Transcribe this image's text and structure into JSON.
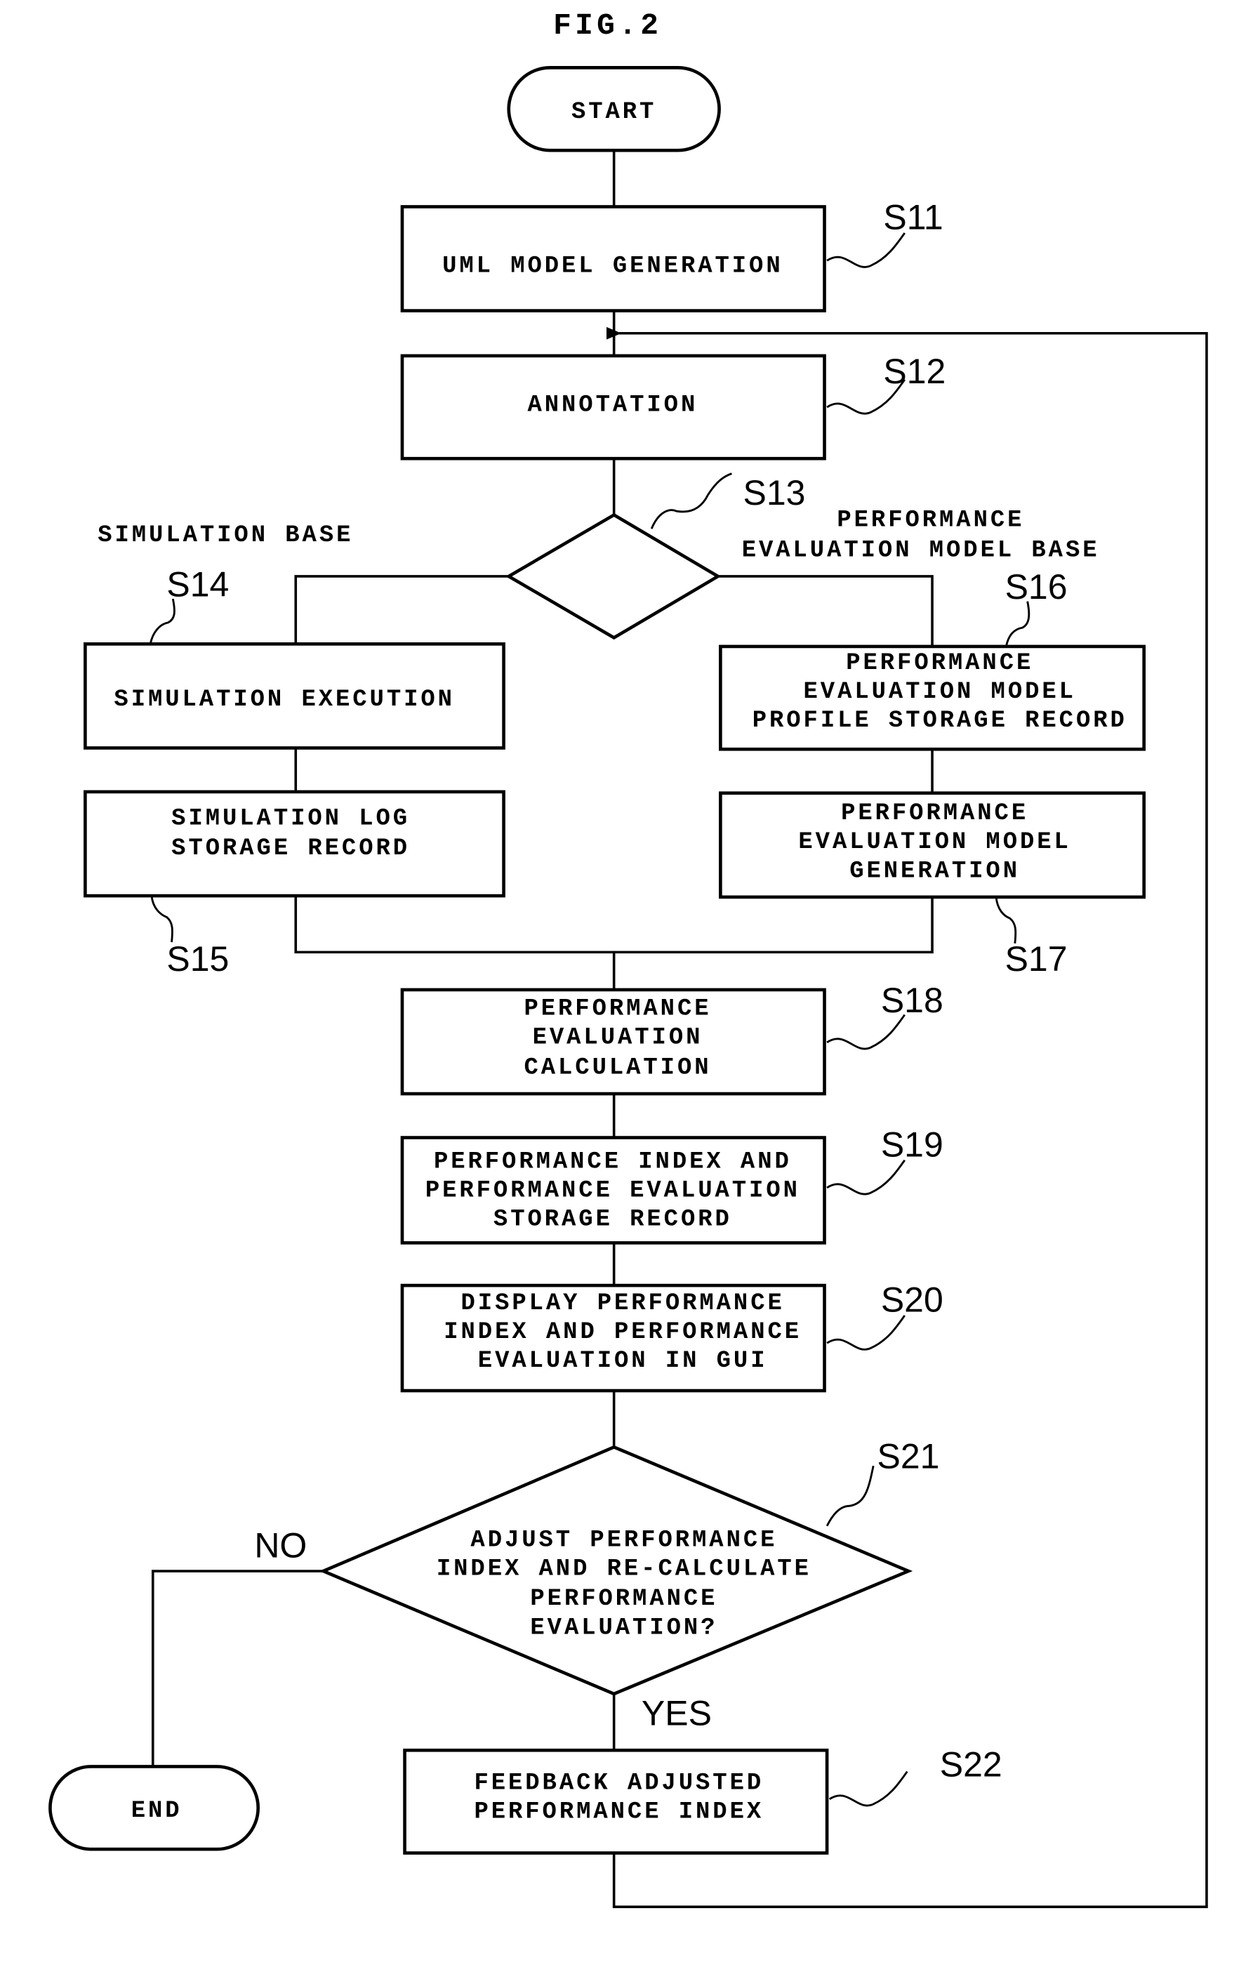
{
  "figure": {
    "title": "FIG.2"
  },
  "terminals": {
    "start": "START",
    "end": "END"
  },
  "steps": {
    "s11": {
      "id": "S11",
      "lines": [
        "UML MODEL GENERATION"
      ]
    },
    "s12": {
      "id": "S12",
      "lines": [
        "ANNOTATION"
      ]
    },
    "s13": {
      "id": "S13",
      "lines": []
    },
    "s14": {
      "id": "S14",
      "lines": [
        "SIMULATION EXECUTION"
      ]
    },
    "s15": {
      "id": "S15",
      "lines": [
        "SIMULATION LOG",
        "STORAGE RECORD"
      ]
    },
    "s16": {
      "id": "S16",
      "lines": [
        "PERFORMANCE",
        "EVALUATION MODEL",
        "PROFILE STORAGE RECORD"
      ]
    },
    "s17": {
      "id": "S17",
      "lines": [
        "PERFORMANCE",
        "EVALUATION MODEL",
        "GENERATION"
      ]
    },
    "s18": {
      "id": "S18",
      "lines": [
        "PERFORMANCE",
        "EVALUATION",
        "CALCULATION"
      ]
    },
    "s19": {
      "id": "S19",
      "lines": [
        "PERFORMANCE INDEX AND",
        "PERFORMANCE EVALUATION",
        "STORAGE RECORD"
      ]
    },
    "s20": {
      "id": "S20",
      "lines": [
        "DISPLAY PERFORMANCE",
        "INDEX AND PERFORMANCE",
        "EVALUATION IN GUI"
      ]
    },
    "s21": {
      "id": "S21",
      "lines": [
        "ADJUST PERFORMANCE",
        "INDEX AND RE-CALCULATE",
        "PERFORMANCE",
        "EVALUATION?"
      ]
    },
    "s22": {
      "id": "S22",
      "lines": [
        "FEEDBACK ADJUSTED",
        "PERFORMANCE INDEX"
      ]
    }
  },
  "branch_labels": {
    "simulation_base": "SIMULATION BASE",
    "model_base": [
      "PERFORMANCE",
      "EVALUATION MODEL BASE"
    ],
    "no": "NO",
    "yes": "YES"
  }
}
